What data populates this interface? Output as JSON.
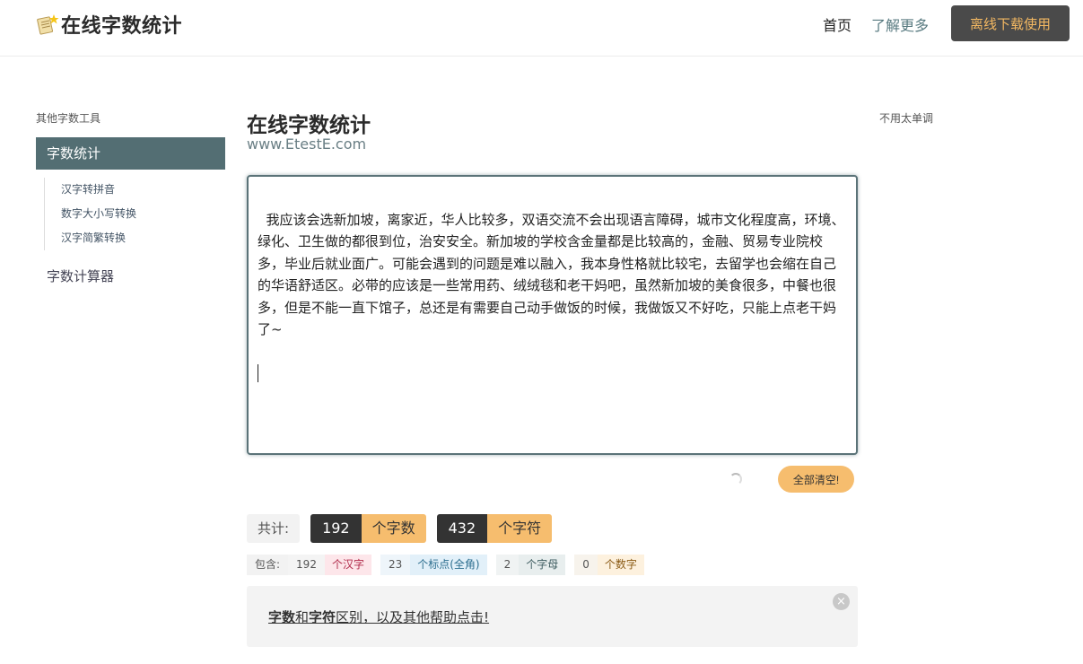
{
  "header": {
    "logo_text": "在线字数统计",
    "nav_home": "首页",
    "nav_more": "了解更多",
    "download_label": "离线下载使用"
  },
  "sidebar": {
    "title": "其他字数工具",
    "active_item": "字数统计",
    "sub_items": [
      "汉字转拼音",
      "数字大小写转换",
      "汉字简繁转换"
    ],
    "calc_item": "字数计算器"
  },
  "right_label": "不用太单调",
  "main": {
    "title": "在线字数统计",
    "subtitle": "www.EtestE.com",
    "text": "我应该会选新加坡，离家近，华人比较多，双语交流不会出现语言障碍，城市文化程度高，环境、绿化、卫生做的都很到位，治安安全。新加坡的学校含金量都是比较高的，金融、贸易专业院校多，毕业后就业面广。可能会遇到的问题是难以融入，我本身性格就比较宅，去留学也会缩在自己的华语舒适区。必带的应该是一些常用药、绒绒毯和老干妈吧，虽然新加坡的美食很多，中餐也很多，但是不能一直下馆子，总还是有需要自己动手做饭的时候，我做饭又不好吃，只能上点老干妈了~",
    "clear_label": "全部清空!"
  },
  "totals": {
    "label": "共计:",
    "word_count": "192",
    "word_unit": "个字数",
    "char_count": "432",
    "char_unit": "个字符"
  },
  "includes": {
    "label": "包含:",
    "han_count": "192",
    "han_unit": "个汉字",
    "punct_count": "23",
    "punct_unit": "个标点(全角)",
    "letter_count": "2",
    "letter_unit": "个字母",
    "digit_count": "0",
    "digit_unit": "个数字"
  },
  "help": {
    "part1": "字数",
    "part2": "和",
    "part3": "字符",
    "part4": "区别，以及其他帮助点击!",
    "close": "×"
  },
  "colors": {
    "accent": "#536e73",
    "orange": "#f6bd6e",
    "dark": "#333333"
  }
}
